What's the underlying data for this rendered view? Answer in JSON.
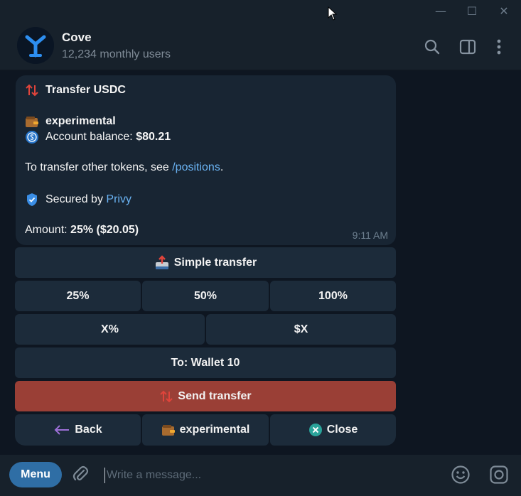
{
  "window": {
    "minimize_glyph": "—",
    "maximize_glyph": "☐",
    "close_glyph": "✕"
  },
  "header": {
    "title": "Cove",
    "subtitle": "12,234 monthly users"
  },
  "message": {
    "heading": "Transfer USDC",
    "wallet_name": "experimental",
    "balance_label": "Account balance: ",
    "balance_value": "$80.21",
    "transfer_note": "To transfer other tokens, see ",
    "positions_link": "/positions",
    "period": ".",
    "secured_label": "Secured by ",
    "privy_link": "Privy",
    "amount_label": "Amount: ",
    "amount_value": "25% ($20.05)",
    "time": "9:11 AM"
  },
  "keyboard": {
    "simple_transfer": "Simple transfer",
    "pct_25": "25%",
    "pct_50": "50%",
    "pct_100": "100%",
    "x_percent": "X%",
    "x_dollar": "$X",
    "to_wallet": "To: Wallet 10",
    "send_transfer": "Send transfer",
    "back": "Back",
    "wallet": "experimental",
    "close": "Close"
  },
  "input": {
    "menu_label": "Menu",
    "placeholder": "Write a message..."
  },
  "colors": {
    "accent": "#6ab3f3",
    "send": "#9a3f36",
    "menu": "#2f6ea5",
    "bubble": "#182533"
  },
  "icons": [
    "transfer-arrows-icon",
    "wallet-icon",
    "usdc-coin-icon",
    "shield-icon",
    "outbox-tray-icon",
    "back-arrow-icon",
    "close-circle-icon",
    "search-icon",
    "sidebar-toggle-icon",
    "more-vertical-icon",
    "attach-icon",
    "emoji-icon",
    "camera-icon"
  ]
}
